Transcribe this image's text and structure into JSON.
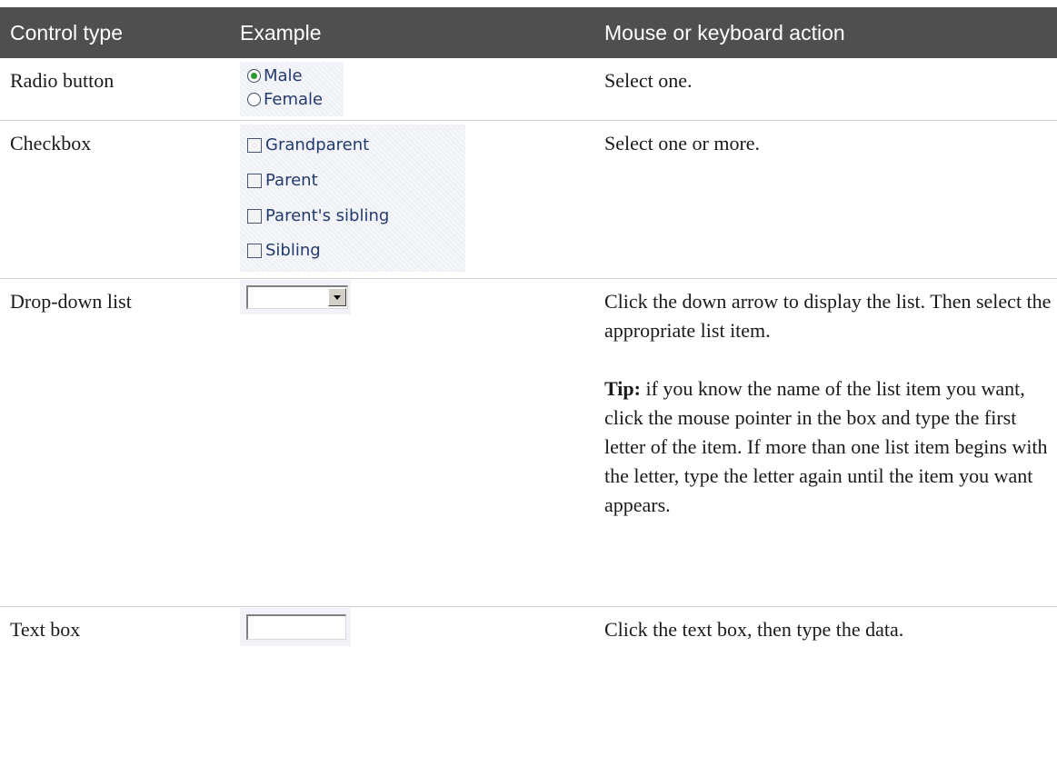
{
  "table": {
    "headers": [
      "Control type",
      "Example",
      "Mouse or keyboard action"
    ],
    "rows": [
      {
        "control_type": "Radio button",
        "example": {
          "options": [
            "Male",
            "Female"
          ],
          "selected": "Male"
        },
        "action": "Select one."
      },
      {
        "control_type": "Checkbox",
        "example": {
          "options": [
            "Grandparent",
            "Parent",
            "Parent's sibling",
            "Sibling"
          ]
        },
        "action": "Select one or more."
      },
      {
        "control_type": "Drop-down list",
        "action": "Click the down arrow to display the list. Then select the appropriate list item.",
        "tip_label": "Tip:",
        "tip_text": " if you know the name of the list item you want, click the mouse pointer in the box and type the first letter of the item. If more than one list item begins with the letter, type the letter again until the item you want appears."
      },
      {
        "control_type": "Text box",
        "action": "Click the text box, then type the data."
      }
    ]
  },
  "colors": {
    "header_background": "#4f4f4f",
    "header_text": "#ffffff",
    "example_background": "#eef0f6",
    "example_text": "#223a6e",
    "radio_selected": "#2e9a2e"
  }
}
